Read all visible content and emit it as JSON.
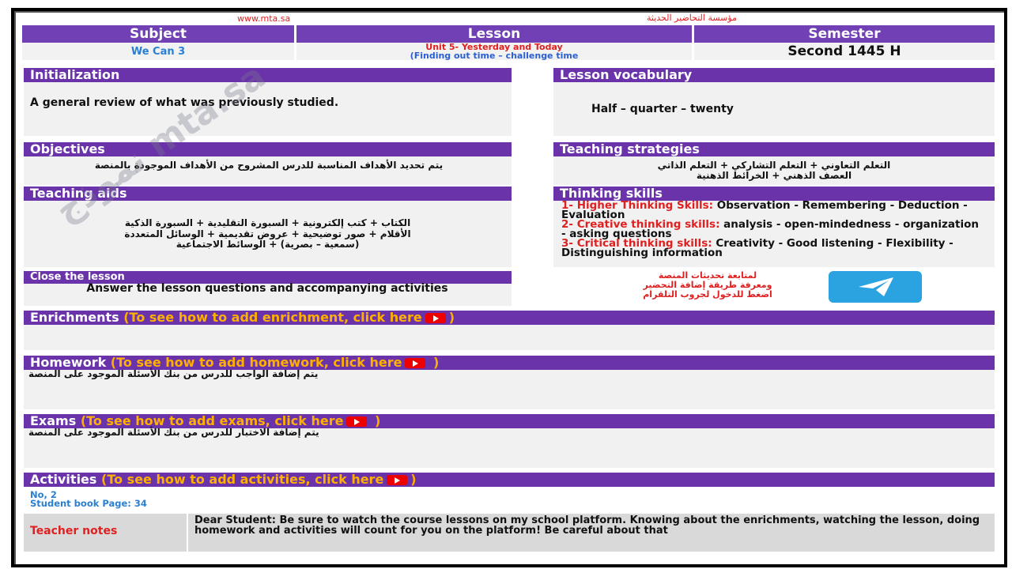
{
  "top": {
    "website": "www.mta.sa",
    "org": "مؤسسة التحاضير الحديثة"
  },
  "header": {
    "subject_label": "Subject",
    "lesson_label": "Lesson",
    "semester_label": "Semester",
    "subject_value": "We Can 3",
    "lesson_line1": "Unit 5- Yesterday and Today",
    "lesson_line2": "(Finding out time – challenge time",
    "semester_value": "Second 1445 H"
  },
  "initialization": {
    "title": "Initialization",
    "text": "A general review of what was previously studied."
  },
  "vocabulary": {
    "title": "Lesson vocabulary",
    "text": "Half – quarter – twenty"
  },
  "objectives": {
    "title": "Objectives",
    "text": "يتم تحديد الأهداف المناسبة للدرس المشروح من الأهداف الموجودة بالمنصة"
  },
  "strategies": {
    "title": "Teaching strategies",
    "line1": "التعلم التعاوني + التعلم التشاركي + التعلم الذاتي",
    "line2": "العصف الذهني + الخرائط الذهنية"
  },
  "aids": {
    "title": "Teaching aids",
    "line1": "الكتاب + كتب إلكترونية + السبورة التقليدية + السبورة الذكية",
    "line2": "الأقلام + صور توضيحية + عروض تقديمية + الوسائل المتعددة",
    "line3": "(سمعية – بصرية) + الوسائط الاجتماعية"
  },
  "thinking": {
    "title": "Thinking skills",
    "l1_label": "1- Higher Thinking Skills:",
    "l1_text": " Observation - Remembering - Deduction - Evaluation",
    "l2_label": "2- Creative thinking skills:",
    "l2_text": " analysis - open-mindedness - organization - asking questions",
    "l3_label": "3- Critical thinking skills:",
    "l3_text": " Creativity - Good listening - Flexibility - Distinguishing information"
  },
  "close": {
    "title": "Close the lesson",
    "text": "Answer the lesson questions and accompanying activities"
  },
  "telegram": {
    "line1": "لمتابعة تحديثات المنصة",
    "line2": "ومعرفة طريقة إضافة التحضير",
    "line3": "اضغط للدخول لجروب التلقرام",
    "icon": "telegram-icon"
  },
  "enrichments": {
    "title": "Enrichments",
    "link": "(To see how to add enrichment, click here",
    "close": ")"
  },
  "homework": {
    "title": "Homework",
    "link": "(To see how to add homework, click here",
    "close": " )",
    "text": "يتم إضافة الواجب للدرس من بنك الأسئلة الموجود على المنصة"
  },
  "exams": {
    "title": "Exams",
    "link": "(To see how to add exams, click here",
    "close": " )",
    "text": "يتم إضافة الاختبار للدرس من بنك الأسئلة الموجود على المنصة"
  },
  "activities": {
    "title": "Activities",
    "link": "(To see how to add activities, click here",
    "close": ")",
    "line1": "No, 2",
    "line2": "Student book Page: 34"
  },
  "notes": {
    "label": "Teacher notes",
    "text": "Dear Student: Be sure to watch the course lessons on my school platform. Knowing about the enrichments, watching the lesson, doing homework and activities will count for you on the platform! Be careful about that"
  },
  "watermark": "نموذج mta.sa",
  "colors": {
    "purple": "#6a33aa",
    "orange": "#ffb000",
    "red": "#e02020",
    "blue": "#2a7fd3"
  }
}
